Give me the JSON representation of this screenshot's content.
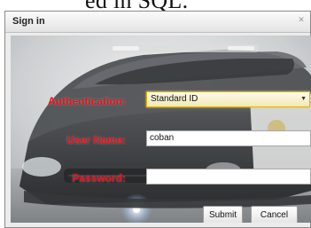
{
  "background": {
    "partial_text": "ed in SQL."
  },
  "dialog": {
    "title": "Sign in",
    "close_glyph": "✕"
  },
  "form": {
    "authentication": {
      "label": "Authentication:",
      "selected": "Standard ID"
    },
    "username": {
      "label": "User Name:",
      "value": "coban"
    },
    "password": {
      "label": "Password:",
      "value": ""
    }
  },
  "buttons": {
    "submit": "Submit",
    "cancel": "Cancel"
  },
  "colors": {
    "label_red": "#e4121c",
    "select_highlight": "#e0b400"
  },
  "icons": {
    "close": "close-icon",
    "dropdown": "chevron-down-icon",
    "background": "police-car-image"
  }
}
